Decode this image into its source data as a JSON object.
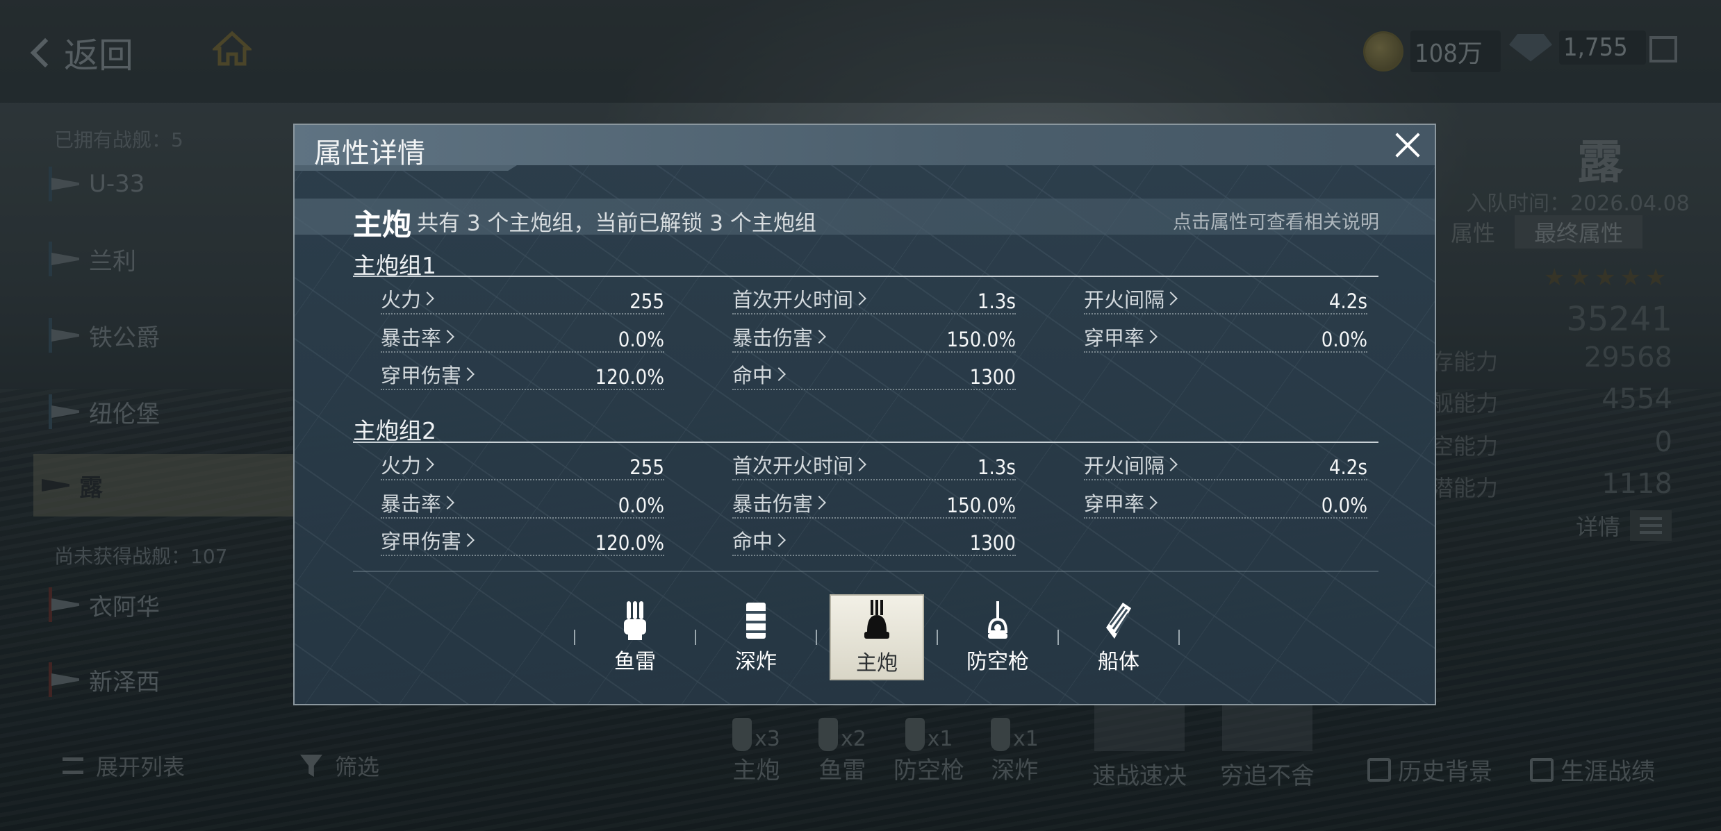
{
  "top": {
    "back_label": "返回",
    "coins": "108万",
    "gems": "1,755"
  },
  "left_list": {
    "owned_label": "已拥有战舰：5",
    "owned": [
      {
        "name": "U-33"
      },
      {
        "name": "兰利"
      },
      {
        "name": "铁公爵"
      },
      {
        "name": "纽伦堡"
      },
      {
        "name": "露"
      }
    ],
    "not_owned_label": "尚未获得战舰：107",
    "not_owned": [
      {
        "name": "衣阿华"
      },
      {
        "name": "新泽西"
      }
    ]
  },
  "right_panel": {
    "ship_name": "露",
    "join_date": "入队时间：2026.04.08",
    "tabs": [
      "属性",
      "最终属性"
    ],
    "stars": "★★★★★",
    "total_power": "35241",
    "powers": [
      {
        "label": "存能力",
        "value": "29568"
      },
      {
        "label": "舰能力",
        "value": "4554"
      },
      {
        "label": "空能力",
        "value": "0"
      },
      {
        "label": "潜能力",
        "value": "1118"
      }
    ],
    "details_label": "详情"
  },
  "bottom_bar": {
    "expand_list": "展开列表",
    "filter": "筛选",
    "weapons": [
      {
        "count": "x3",
        "label": "主炮"
      },
      {
        "count": "x2",
        "label": "鱼雷"
      },
      {
        "count": "x1",
        "label": "防空枪"
      },
      {
        "count": "x1",
        "label": "深炸"
      }
    ],
    "skills": [
      "速战速决",
      "穷追不舍"
    ],
    "history": "历史背景",
    "career": "生涯战绩"
  },
  "modal": {
    "title": "属性详情",
    "section_title": "主炮",
    "section_desc": "共有 3 个主炮组，当前已解锁 3 个主炮组",
    "hint": "点击属性可查看相关说明",
    "groups": [
      {
        "title": "主炮组1",
        "attrs": [
          {
            "label": "火力",
            "value": "255"
          },
          {
            "label": "首次开火时间",
            "value": "1.3s"
          },
          {
            "label": "开火间隔",
            "value": "4.2s"
          },
          {
            "label": "暴击率",
            "value": "0.0%"
          },
          {
            "label": "暴击伤害",
            "value": "150.0%"
          },
          {
            "label": "穿甲率",
            "value": "0.0%"
          },
          {
            "label": "穿甲伤害",
            "value": "120.0%"
          },
          {
            "label": "命中",
            "value": "1300"
          }
        ]
      },
      {
        "title": "主炮组2",
        "attrs": [
          {
            "label": "火力",
            "value": "255"
          },
          {
            "label": "首次开火时间",
            "value": "1.3s"
          },
          {
            "label": "开火间隔",
            "value": "4.2s"
          },
          {
            "label": "暴击率",
            "value": "0.0%"
          },
          {
            "label": "暴击伤害",
            "value": "150.0%"
          },
          {
            "label": "穿甲率",
            "value": "0.0%"
          },
          {
            "label": "穿甲伤害",
            "value": "120.0%"
          },
          {
            "label": "命中",
            "value": "1300"
          }
        ]
      }
    ],
    "weapon_tabs": [
      {
        "label": "鱼雷",
        "icon": "torpedo-icon"
      },
      {
        "label": "深炸",
        "icon": "depth-charge-icon"
      },
      {
        "label": "主炮",
        "icon": "main-gun-icon",
        "active": true
      },
      {
        "label": "防空枪",
        "icon": "aa-gun-icon"
      },
      {
        "label": "船体",
        "icon": "hull-icon"
      }
    ]
  }
}
